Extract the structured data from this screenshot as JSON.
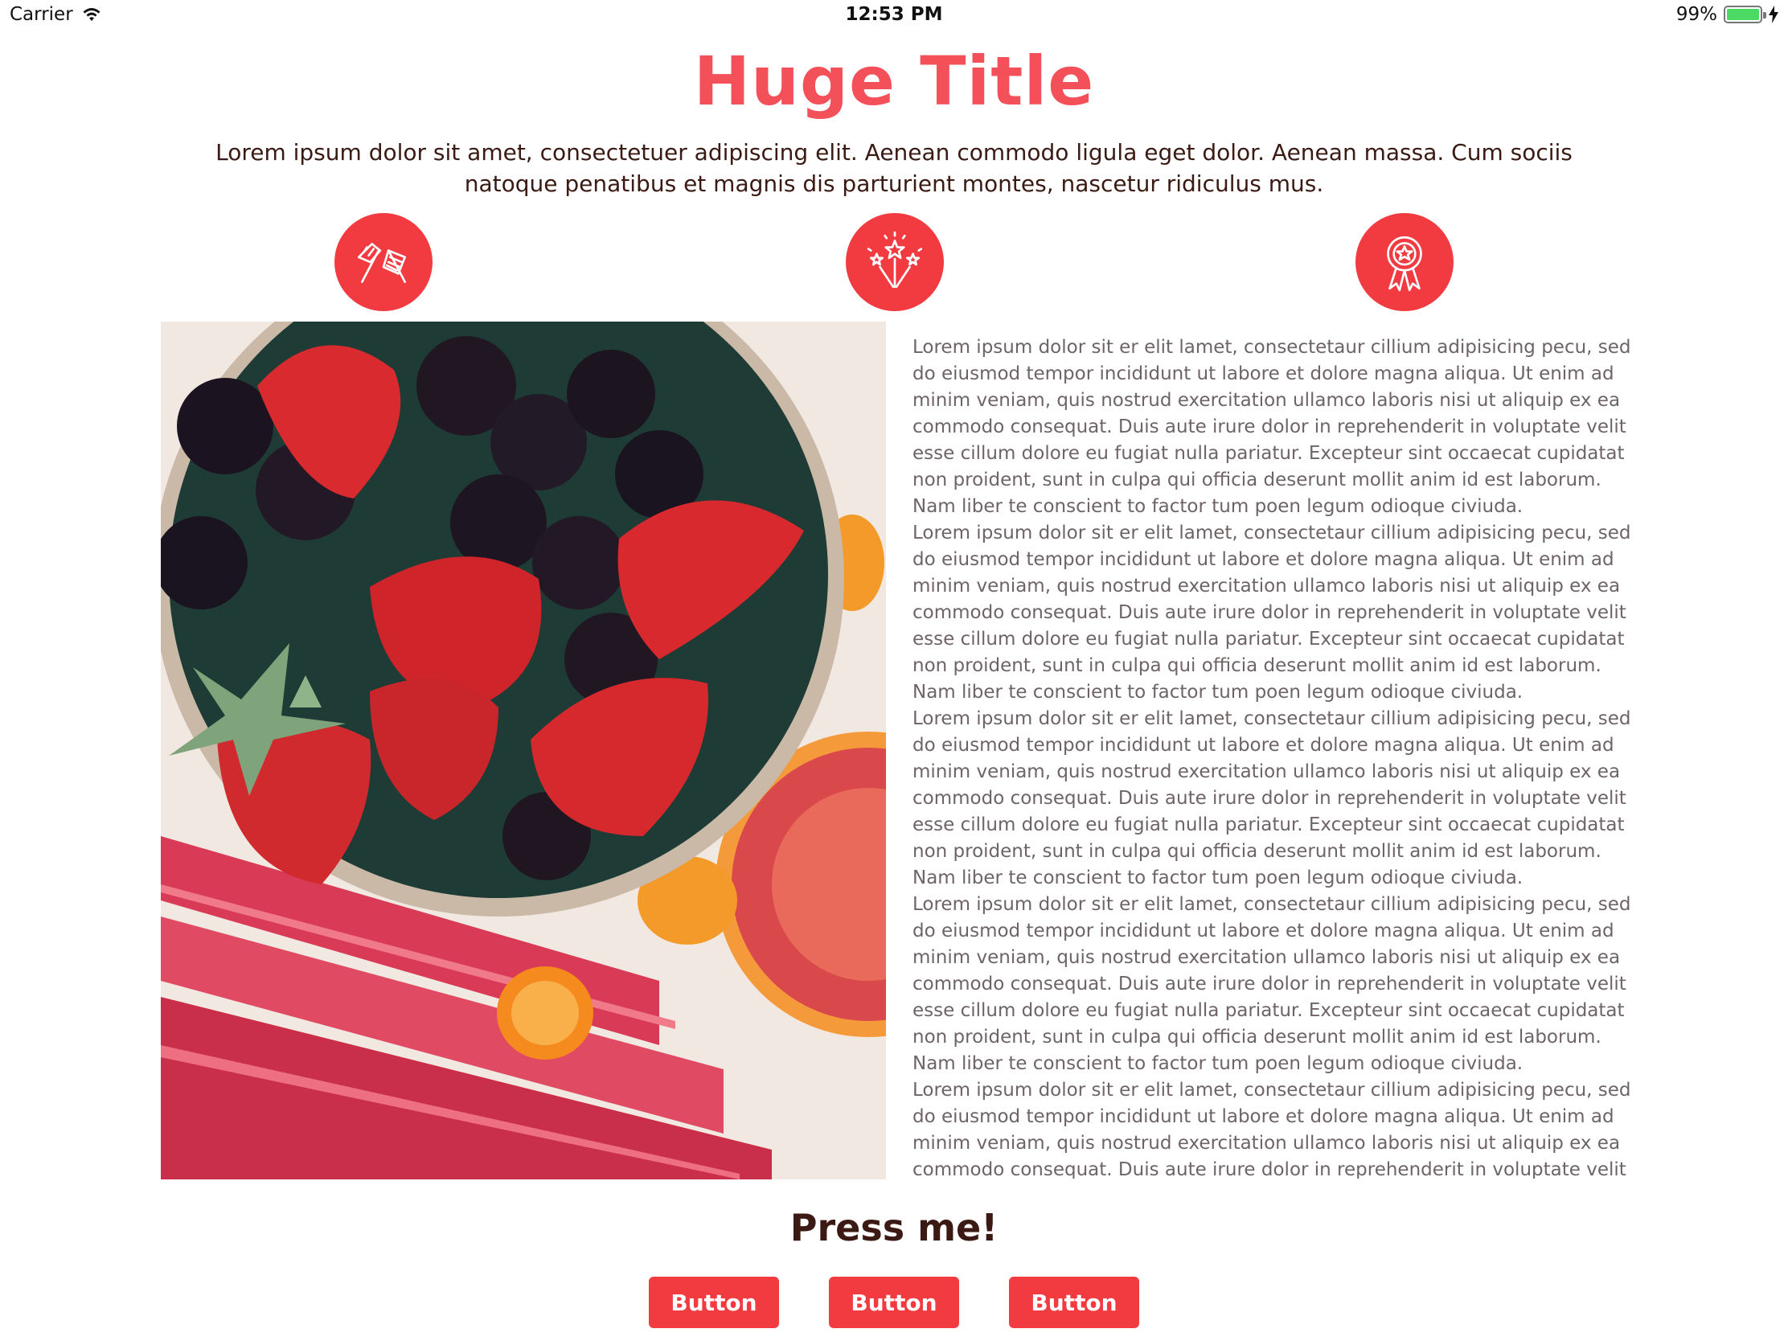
{
  "status_bar": {
    "carrier": "Carrier",
    "time": "12:53 PM",
    "battery_percent": "99%",
    "battery_level": 0.99
  },
  "header": {
    "title": "Huge Title",
    "intro": "Lorem ipsum dolor sit amet, consectetuer adipiscing elit. Aenean commodo ligula eget dolor. Aenean massa. Cum sociis natoque penatibus et magnis dis parturient montes, nascetur ridiculus mus."
  },
  "icons": [
    "flags-icon",
    "fireworks-icon",
    "award-ribbon-icon"
  ],
  "body_paragraphs": [
    "Lorem ipsum dolor sit er elit lamet, consectetaur cillium adipisicing pecu, sed do eiusmod tempor incididunt ut labore et dolore magna aliqua. Ut enim ad minim veniam, quis nostrud exercitation ullamco laboris nisi ut aliquip ex ea commodo consequat. Duis aute irure dolor in reprehenderit in voluptate velit esse cillum dolore eu fugiat nulla pariatur. Excepteur sint occaecat cupidatat non proident, sunt in culpa qui officia deserunt mollit anim id est laborum. Nam liber te conscient to factor tum poen legum odioque civiuda.",
    "Lorem ipsum dolor sit er elit lamet, consectetaur cillium adipisicing pecu, sed do eiusmod tempor incididunt ut labore et dolore magna aliqua. Ut enim ad minim veniam, quis nostrud exercitation ullamco laboris nisi ut aliquip ex ea commodo consequat. Duis aute irure dolor in reprehenderit in voluptate velit esse cillum dolore eu fugiat nulla pariatur. Excepteur sint occaecat cupidatat non proident, sunt in culpa qui officia deserunt mollit anim id est laborum. Nam liber te conscient to factor tum poen legum odioque civiuda.",
    "Lorem ipsum dolor sit er elit lamet, consectetaur cillium adipisicing pecu, sed do eiusmod tempor incididunt ut labore et dolore magna aliqua. Ut enim ad minim veniam, quis nostrud exercitation ullamco laboris nisi ut aliquip ex ea commodo consequat. Duis aute irure dolor in reprehenderit in voluptate velit esse cillum dolore eu fugiat nulla pariatur. Excepteur sint occaecat cupidatat non proident, sunt in culpa qui officia deserunt mollit anim id est laborum. Nam liber te conscient to factor tum poen legum odioque civiuda.",
    "Lorem ipsum dolor sit er elit lamet, consectetaur cillium adipisicing pecu, sed do eiusmod tempor incididunt ut labore et dolore magna aliqua. Ut enim ad minim veniam, quis nostrud exercitation ullamco laboris nisi ut aliquip ex ea commodo consequat. Duis aute irure dolor in reprehenderit in voluptate velit esse cillum dolore eu fugiat nulla pariatur. Excepteur sint occaecat cupidatat non proident, sunt in culpa qui officia deserunt mollit anim id est laborum. Nam liber te conscient to factor tum poen legum odioque civiuda.",
    "Lorem ipsum dolor sit er elit lamet, consectetaur cillium adipisicing pecu, sed do eiusmod tempor incididunt ut labore et dolore magna aliqua. Ut enim ad minim veniam, quis nostrud exercitation ullamco laboris nisi ut aliquip ex ea commodo consequat. Duis aute irure dolor in reprehenderit in voluptate velit esse cillum"
  ],
  "cta": {
    "heading": "Press me!",
    "buttons": [
      "Button",
      "Button",
      "Button"
    ]
  },
  "colors": {
    "accent": "#f23b40",
    "title": "#f4505a",
    "dark_text": "#3a1a12",
    "body_text": "#6e6466"
  }
}
